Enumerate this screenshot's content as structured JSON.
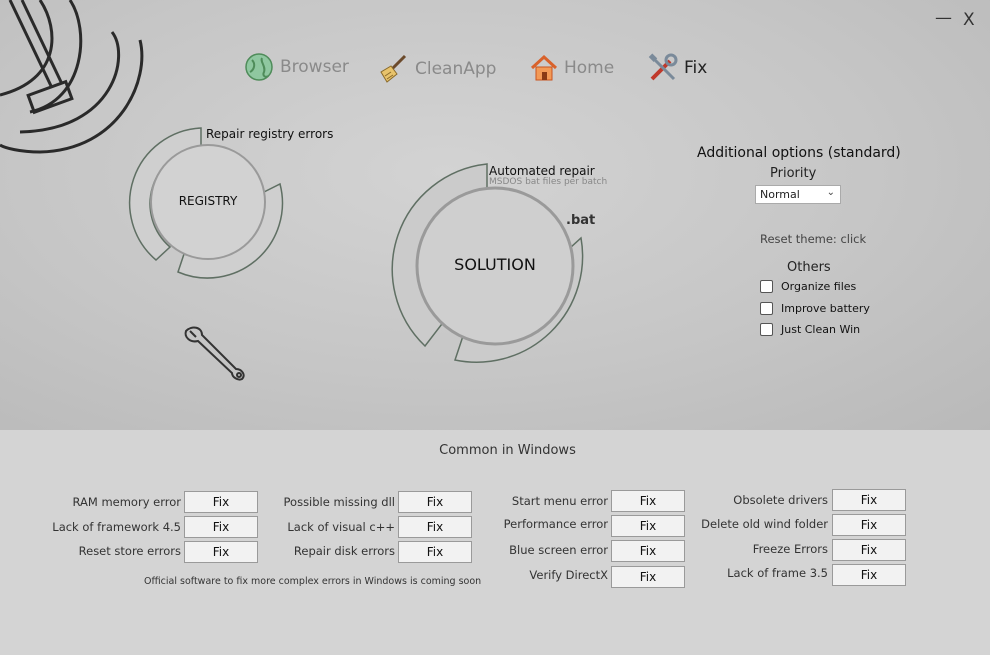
{
  "window": {
    "minimize": "—",
    "close": "X"
  },
  "nav": {
    "items": [
      {
        "label": "Browser",
        "icon": "globe-icon"
      },
      {
        "label": "CleanApp",
        "icon": "broom-icon"
      },
      {
        "label": "Home",
        "icon": "home-icon"
      },
      {
        "label": "Fix",
        "icon": "tools-icon",
        "active": true
      }
    ]
  },
  "registry": {
    "title": "Repair registry errors",
    "center": "REGISTRY"
  },
  "solution": {
    "title": "Automated repair",
    "subtitle": "MSDOS bat files per batch",
    "center": "SOLUTION",
    "badge": ".bat"
  },
  "options": {
    "title": "Additional options (standard)",
    "priority_label": "Priority",
    "priority_value": "Normal",
    "reset_theme": "Reset theme: click",
    "others_label": "Others",
    "checkboxes": [
      {
        "label": "Organize files",
        "checked": false
      },
      {
        "label": "Improve battery",
        "checked": false
      },
      {
        "label": "Just Clean Win",
        "checked": false
      }
    ]
  },
  "common": {
    "title": "Common in Windows",
    "fix_label": "Fix",
    "col1": [
      "RAM memory error",
      "Lack of framework 4.5",
      "Reset store errors"
    ],
    "col2": [
      "Possible missing dll",
      "Lack of visual c++",
      "Repair disk errors"
    ],
    "col3": [
      "Start menu error",
      "Performance error",
      "Blue screen error",
      "Verify DirectX"
    ],
    "col4": [
      "Obsolete drivers",
      "Delete old wind folder",
      "Freeze Errors",
      "Lack of frame 3.5"
    ],
    "footnote": "Official software to fix more complex errors in Windows is coming soon"
  },
  "colors": {
    "ring": "#5f6f63",
    "accent_orange": "#e0742d",
    "globe_green": "#4f8c5a",
    "tool_red": "#c0392b"
  }
}
